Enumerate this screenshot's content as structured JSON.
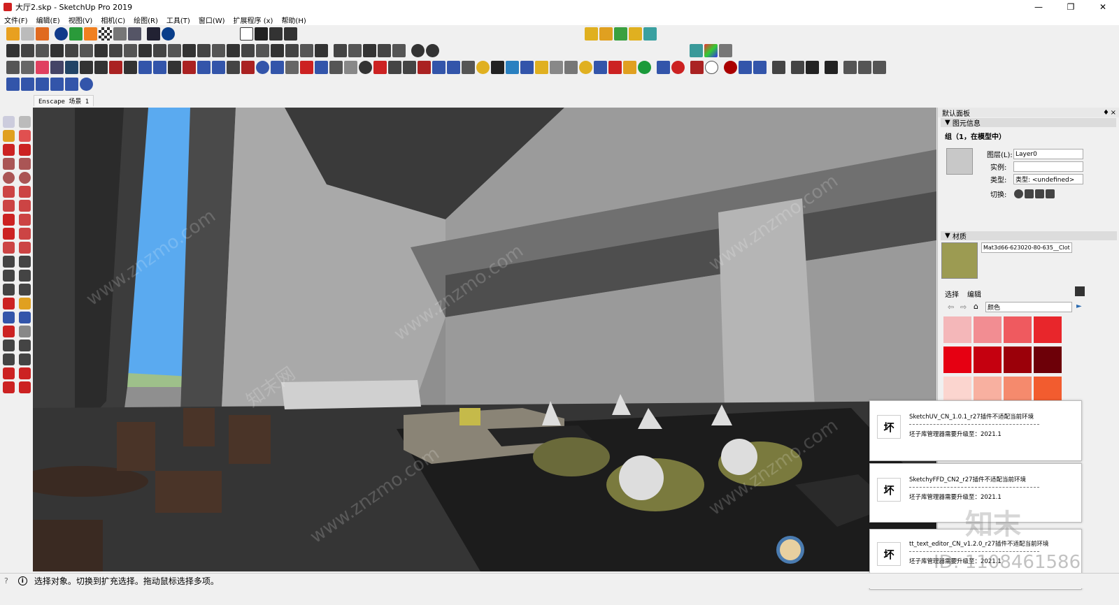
{
  "window": {
    "title": "大厅2.skp - SketchUp Pro 2019",
    "minimize": "—",
    "maximize": "❐",
    "close": "✕"
  },
  "menu": [
    "文件(F)",
    "编辑(E)",
    "视图(V)",
    "相机(C)",
    "绘图(R)",
    "工具(T)",
    "窗口(W)",
    "扩展程序 (x)",
    "帮助(H)"
  ],
  "scene_tab": "Enscape 场景 1",
  "status": {
    "message": "选择对象。切换到扩充选择。拖动鼠标选择多项。",
    "help": "?",
    "info": "i"
  },
  "panel": {
    "title": "默认面板",
    "pin": "♦",
    "close": "×",
    "entity": {
      "header": "图元信息",
      "selection": "组（1，在模型中）",
      "layer_label": "图层(L):",
      "layer_value": "Layer0",
      "instance_label": "实例:",
      "type_label": "类型:",
      "type_value": "类型: <undefined>",
      "toggle_label": "切换:"
    },
    "materials": {
      "header": "材质",
      "name": "Mat3d66-623020-80-635__Clot",
      "tab_select": "选择",
      "tab_edit": "编辑",
      "library": "颜色",
      "swatches": [
        "#f4b7b9",
        "#f28d92",
        "#ef5a5f",
        "#e8262b",
        "#e60012",
        "#c5000f",
        "#9b0009",
        "#6d0008",
        "#fbd5cf",
        "#f8b0a0",
        "#f58a6d",
        "#f25c2f"
      ],
      "current_color": "#9c9b52"
    }
  },
  "notifications": [
    {
      "logo": "坏",
      "title": "SketchUV_CN_1.0.1_r27插件不适配当前环境",
      "body": "坯子库管理器需要升级至：2021.1"
    },
    {
      "logo": "坏",
      "title": "SketchyFFD_CN2_r27插件不适配当前环境",
      "body": "坯子库管理器需要升级至：2021.1"
    },
    {
      "logo": "坏",
      "title": "tt_text_editor_CN_v1.2.0_r27插件不适配当前环境",
      "body": "坯子库管理器需要升级至：2021.1"
    }
  ],
  "watermark": {
    "text": "www.znzmo.com",
    "cn": "知末网",
    "corner_logo": "知末",
    "id_text": "ID: 1108461586"
  }
}
